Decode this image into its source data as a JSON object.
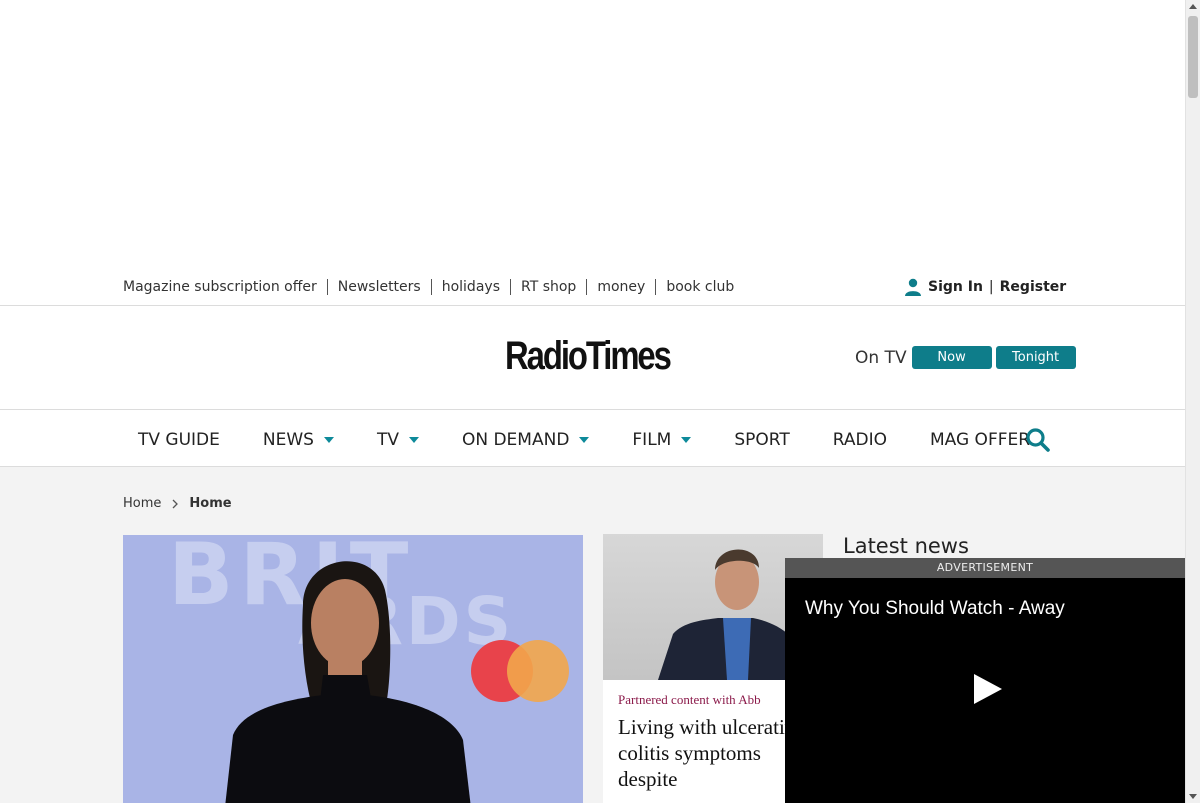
{
  "utility": {
    "links": [
      "Magazine subscription offer",
      "Newsletters",
      "holidays",
      "RT shop",
      "money",
      "book club"
    ],
    "sign_in": "Sign In",
    "separator": "|",
    "register": "Register"
  },
  "masthead": {
    "logo_text": "RadioTimes",
    "on_tv_label": "On TV",
    "now_label": "Now",
    "tonight_label": "Tonight"
  },
  "nav": {
    "items": [
      {
        "label": "TV GUIDE",
        "dropdown": false
      },
      {
        "label": "NEWS",
        "dropdown": true
      },
      {
        "label": "TV",
        "dropdown": true
      },
      {
        "label": "ON DEMAND",
        "dropdown": true
      },
      {
        "label": "FILM",
        "dropdown": true
      },
      {
        "label": "SPORT",
        "dropdown": false
      },
      {
        "label": "RADIO",
        "dropdown": false
      },
      {
        "label": "MAG OFFER",
        "dropdown": false
      }
    ]
  },
  "breadcrumb": {
    "home": "Home",
    "current": "Home"
  },
  "card": {
    "kicker": "Partnered content with Abb",
    "title": "Living with ulcerative colitis symptoms despite"
  },
  "latest_news": {
    "heading": "Latest news"
  },
  "video_ad": {
    "label": "ADVERTISEMENT",
    "title": "Why You Should Watch - Away"
  },
  "colors": {
    "accent_teal": "#0e7d8a",
    "kicker_maroon": "#8b1a4a",
    "background_grey": "#f3f3f3"
  }
}
